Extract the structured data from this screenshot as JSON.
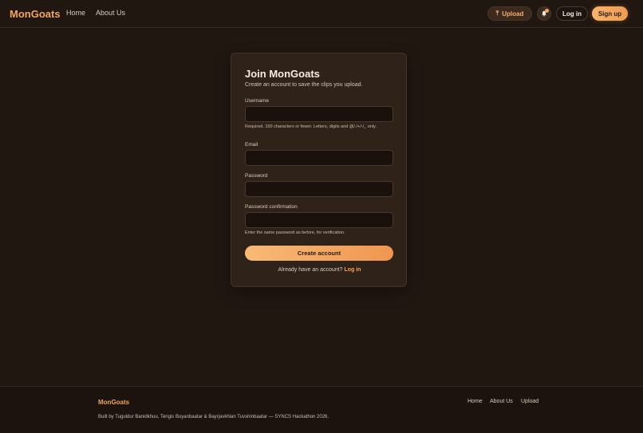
{
  "header": {
    "brand": "MonGoats",
    "nav": {
      "home": "Home",
      "about": "About Us"
    },
    "upload_label": "Upload",
    "upload_icon": "upload-icon",
    "bell_icon": "bell-icon",
    "login_label": "Log in",
    "signup_label": "Sign up"
  },
  "form": {
    "title": "Join MonGoats",
    "subtitle": "Create an account to save the clips you upload.",
    "fields": [
      {
        "label": "Username",
        "value": "",
        "help": "Required. 150 characters or fewer. Letters, digits and @/./+/-/_ only."
      },
      {
        "label": "Email",
        "value": ""
      },
      {
        "label": "Password",
        "value": ""
      },
      {
        "label": "Password confirmation",
        "value": "",
        "help": "Enter the same password as before, for verification."
      }
    ],
    "submit_label": "Create account",
    "login_prompt": "Already have an account?",
    "login_link": "Log in"
  },
  "footer": {
    "brand": "MonGoats",
    "credit": "Built by Tuguldur Banidkhuu, Tengis Buyanbaatar & Bayrjavkhlan Tuvshinbaatar — SYNCS Hackathon 2026.",
    "links": {
      "home": "Home",
      "about": "About Us",
      "upload": "Upload"
    }
  },
  "colors": {
    "background": "#211711",
    "card": "#2f2219",
    "accent": "#f2a55c",
    "input": "#1a110c"
  }
}
